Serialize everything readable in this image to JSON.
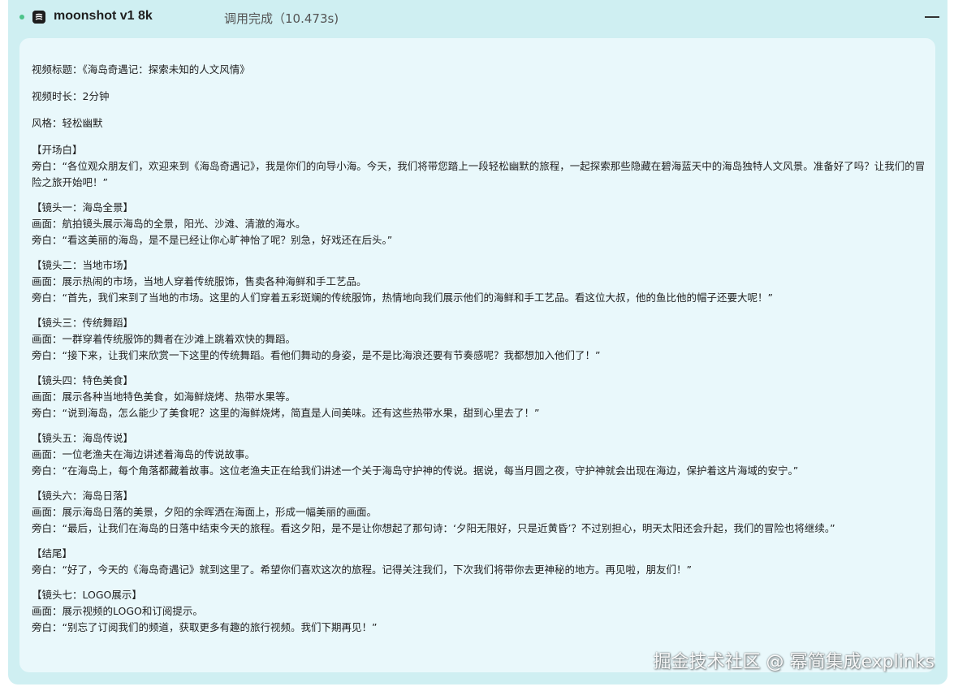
{
  "header": {
    "model_name": "moonshot v1 8k",
    "call_status": "调用完成（10.473s)",
    "collapse_icon": "minus-icon",
    "logo_icon": "moonshot-logo-icon",
    "status_color": "#4cc38a"
  },
  "content": {
    "title_line": "视频标题：《海岛奇遇记：探索未知的人文风情》",
    "duration_line": "视频时长：2分钟",
    "style_line": "风格：轻松幽默",
    "sections": [
      {
        "heading": "【开场白】",
        "lines": [
          "旁白：“各位观众朋友们，欢迎来到《海岛奇遇记》，我是你们的向导小海。今天，我们将带您踏上一段轻松幽默的旅程，一起探索那些隐藏在碧海蓝天中的海岛独特人文风景。准备好了吗？让我们的冒险之旅开始吧！”"
        ]
      },
      {
        "heading": "【镜头一：海岛全景】",
        "lines": [
          "画面：航拍镜头展示海岛的全景，阳光、沙滩、清澈的海水。",
          "旁白：“看这美丽的海岛，是不是已经让你心旷神怡了呢？别急，好戏还在后头。”"
        ]
      },
      {
        "heading": "【镜头二：当地市场】",
        "lines": [
          "画面：展示热闹的市场，当地人穿着传统服饰，售卖各种海鲜和手工艺品。",
          "旁白：“首先，我们来到了当地的市场。这里的人们穿着五彩斑斓的传统服饰，热情地向我们展示他们的海鲜和手工艺品。看这位大叔，他的鱼比他的帽子还要大呢！”"
        ]
      },
      {
        "heading": "【镜头三：传统舞蹈】",
        "lines": [
          "画面：一群穿着传统服饰的舞者在沙滩上跳着欢快的舞蹈。",
          "旁白：“接下来，让我们来欣赏一下这里的传统舞蹈。看他们舞动的身姿，是不是比海浪还要有节奏感呢？我都想加入他们了！”"
        ]
      },
      {
        "heading": "【镜头四：特色美食】",
        "lines": [
          "画面：展示各种当地特色美食，如海鲜烧烤、热带水果等。",
          "旁白：“说到海岛，怎么能少了美食呢？这里的海鲜烧烤，简直是人间美味。还有这些热带水果，甜到心里去了！”"
        ]
      },
      {
        "heading": "【镜头五：海岛传说】",
        "lines": [
          "画面：一位老渔夫在海边讲述着海岛的传说故事。",
          "旁白：“在海岛上，每个角落都藏着故事。这位老渔夫正在给我们讲述一个关于海岛守护神的传说。据说，每当月圆之夜，守护神就会出现在海边，保护着这片海域的安宁。”"
        ]
      },
      {
        "heading": "【镜头六：海岛日落】",
        "lines": [
          "画面：展示海岛日落的美景，夕阳的余晖洒在海面上，形成一幅美丽的画面。",
          "旁白：“最后，让我们在海岛的日落中结束今天的旅程。看这夕阳，是不是让你想起了那句诗：‘夕阳无限好，只是近黄昏’？不过别担心，明天太阳还会升起，我们的冒险也将继续。”"
        ]
      },
      {
        "heading": "【结尾】",
        "lines": [
          "旁白：“好了，今天的《海岛奇遇记》就到这里了。希望你们喜欢这次的旅程。记得关注我们，下次我们将带你去更神秘的地方。再见啦，朋友们！”"
        ]
      },
      {
        "heading": "【镜头七：LOGO展示】",
        "lines": [
          "画面：展示视频的LOGO和订阅提示。",
          "旁白：“别忘了订阅我们的频道，获取更多有趣的旅行视频。我们下期再见！”"
        ]
      }
    ]
  },
  "watermark": "掘金技术社区 @ 幂简集成explinks"
}
